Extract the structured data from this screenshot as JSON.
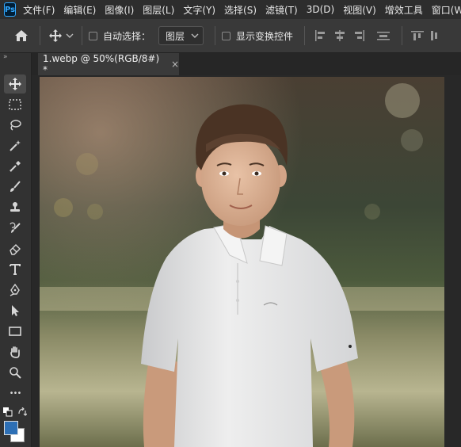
{
  "app": {
    "logo": "Ps"
  },
  "menu": [
    "文件(F)",
    "编辑(E)",
    "图像(I)",
    "图层(L)",
    "文字(Y)",
    "选择(S)",
    "滤镜(T)",
    "3D(D)",
    "视图(V)",
    "增效工具",
    "窗口(W)"
  ],
  "options": {
    "auto_select_label": "自动选择：",
    "auto_select_value": "图层",
    "show_transform_label": "显示变换控件"
  },
  "document": {
    "tab_title": "1.webp @ 50%(RGB/8#) *",
    "close": "×"
  },
  "toolbar": {
    "collapse": "»",
    "more": "•••"
  },
  "colors": {
    "foreground": "#2d6fb5",
    "background": "#ffffff",
    "accent": "#31a8ff"
  },
  "image": {
    "description_icon": "photo-canvas"
  }
}
